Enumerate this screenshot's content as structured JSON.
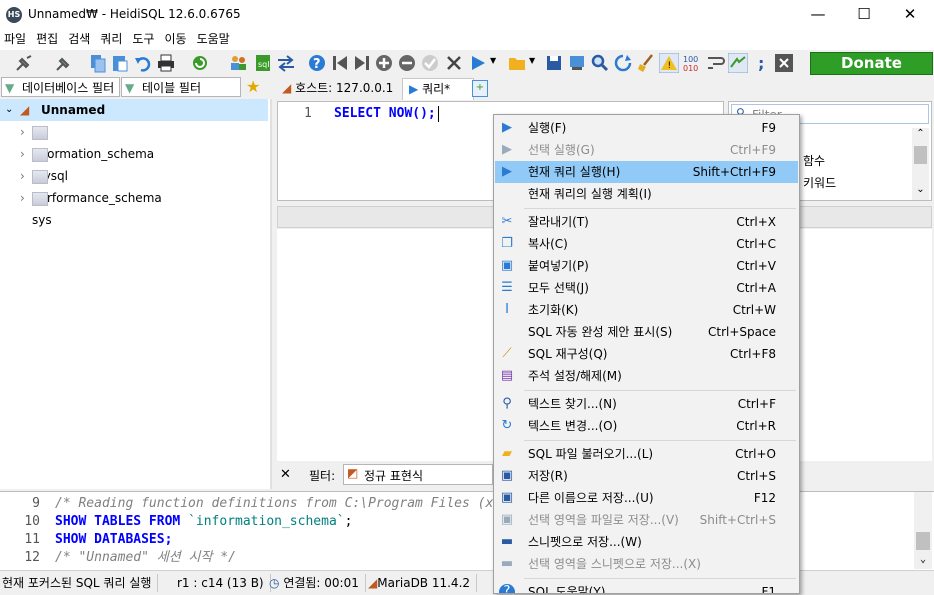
{
  "window": {
    "title": "Unnamed₩ - HeidiSQL 12.6.0.6765",
    "app_icon": "HS",
    "minimize": "—",
    "maximize": "☐",
    "close": "✕"
  },
  "menu": [
    "파일",
    "편집",
    "검색",
    "쿼리",
    "도구",
    "이동",
    "도움말"
  ],
  "toolbar": {
    "donate_label": "Donate"
  },
  "left_filters": {
    "db_filter": "데이터베이스 필터",
    "table_filter": "테이블 필터"
  },
  "tree": {
    "root": "Unnamed",
    "databases": [
      "information_schema",
      "mysql",
      "performance_schema",
      "sys"
    ]
  },
  "tabs": {
    "host": "호스트: 127.0.0.1",
    "query": "쿼리*"
  },
  "editor": {
    "line_number": "1",
    "code": "SELECT NOW();"
  },
  "right_panel": {
    "filter_placeholder": "Filter",
    "items": [
      "함수",
      "키워드"
    ]
  },
  "bottom_filter": {
    "close": "✕",
    "label": "필터:",
    "value": "정규 표현식"
  },
  "log": [
    {
      "n": "9",
      "text": "/* Reading function definitions from C:\\Program Files (x86)\\HeidiSQL\\functions-m",
      "kind": "comment"
    },
    {
      "n": "10",
      "text": "SHOW TABLES FROM `information_schema`;",
      "kind": "sql"
    },
    {
      "n": "11",
      "text": "SHOW DATABASES;",
      "kind": "sql"
    },
    {
      "n": "12",
      "text": "/* \"Unnamed\" 세션 시작 */",
      "kind": "comment"
    }
  ],
  "status": {
    "message": "현재 포커스된 SQL 쿼리 실행",
    "position": "r1 : c14 (13 B)",
    "connected": "연결됨: 00:01",
    "server": "MariaDB 11.4.2"
  },
  "context_menu": [
    {
      "label": "실행(F)",
      "shortcut": "F9",
      "icon": "play-icon",
      "disabled": false
    },
    {
      "label": "선택 실행(G)",
      "shortcut": "Ctrl+F9",
      "icon": "play-selection-icon",
      "disabled": true
    },
    {
      "label": "현재 쿼리 실행(H)",
      "shortcut": "Shift+Ctrl+F9",
      "icon": "play-current-icon",
      "disabled": false,
      "highlighted": true
    },
    {
      "label": "현재 쿼리의 실행 계획(I)",
      "shortcut": "",
      "icon": "",
      "disabled": false
    },
    {
      "label": "잘라내기(T)",
      "shortcut": "Ctrl+X",
      "icon": "scissors-icon",
      "disabled": false
    },
    {
      "label": "복사(C)",
      "shortcut": "Ctrl+C",
      "icon": "copy-icon",
      "disabled": false
    },
    {
      "label": "붙여넣기(P)",
      "shortcut": "Ctrl+V",
      "icon": "paste-icon",
      "disabled": false
    },
    {
      "label": "모두 선택(J)",
      "shortcut": "Ctrl+A",
      "icon": "select-all-icon",
      "disabled": false
    },
    {
      "label": "초기화(K)",
      "shortcut": "Ctrl+W",
      "icon": "clear-icon",
      "disabled": false
    },
    {
      "label": "SQL 자동 완성 제안 표시(S)",
      "shortcut": "Ctrl+Space",
      "icon": "",
      "disabled": false
    },
    {
      "label": "SQL 재구성(Q)",
      "shortcut": "Ctrl+F8",
      "icon": "broom-icon",
      "disabled": false
    },
    {
      "label": "주석 설정/해제(M)",
      "shortcut": "",
      "icon": "comment-icon",
      "disabled": false
    },
    {
      "label": "텍스트 찾기...(N)",
      "shortcut": "Ctrl+F",
      "icon": "search-icon",
      "disabled": false
    },
    {
      "label": "텍스트 변경...(O)",
      "shortcut": "Ctrl+R",
      "icon": "replace-icon",
      "disabled": false
    },
    {
      "label": "SQL 파일 불러오기...(L)",
      "shortcut": "Ctrl+O",
      "icon": "folder-icon",
      "disabled": false
    },
    {
      "label": "저장(R)",
      "shortcut": "Ctrl+S",
      "icon": "save-icon",
      "disabled": false
    },
    {
      "label": "다른 이름으로 저장...(U)",
      "shortcut": "F12",
      "icon": "save-as-icon",
      "disabled": false
    },
    {
      "label": "선택 영역을 파일로 저장...(V)",
      "shortcut": "Shift+Ctrl+S",
      "icon": "save-selection-icon",
      "disabled": true
    },
    {
      "label": "스니펫으로 저장...(W)",
      "shortcut": "",
      "icon": "save-snippet-icon",
      "disabled": false
    },
    {
      "label": "선택 영역을 스니펫으로 저장...(X)",
      "shortcut": "",
      "icon": "save-selection-snippet-icon",
      "disabled": true
    },
    {
      "label": "SQL 도움말(Y)",
      "shortcut": "F1",
      "icon": "help-icon",
      "disabled": false
    }
  ],
  "colors": {
    "accent": "#91c9f7",
    "tree_selected": "#cce8ff",
    "keyword": "#0000ff",
    "comment": "#808080",
    "string": "#008080",
    "donate": "#2e9e26"
  }
}
